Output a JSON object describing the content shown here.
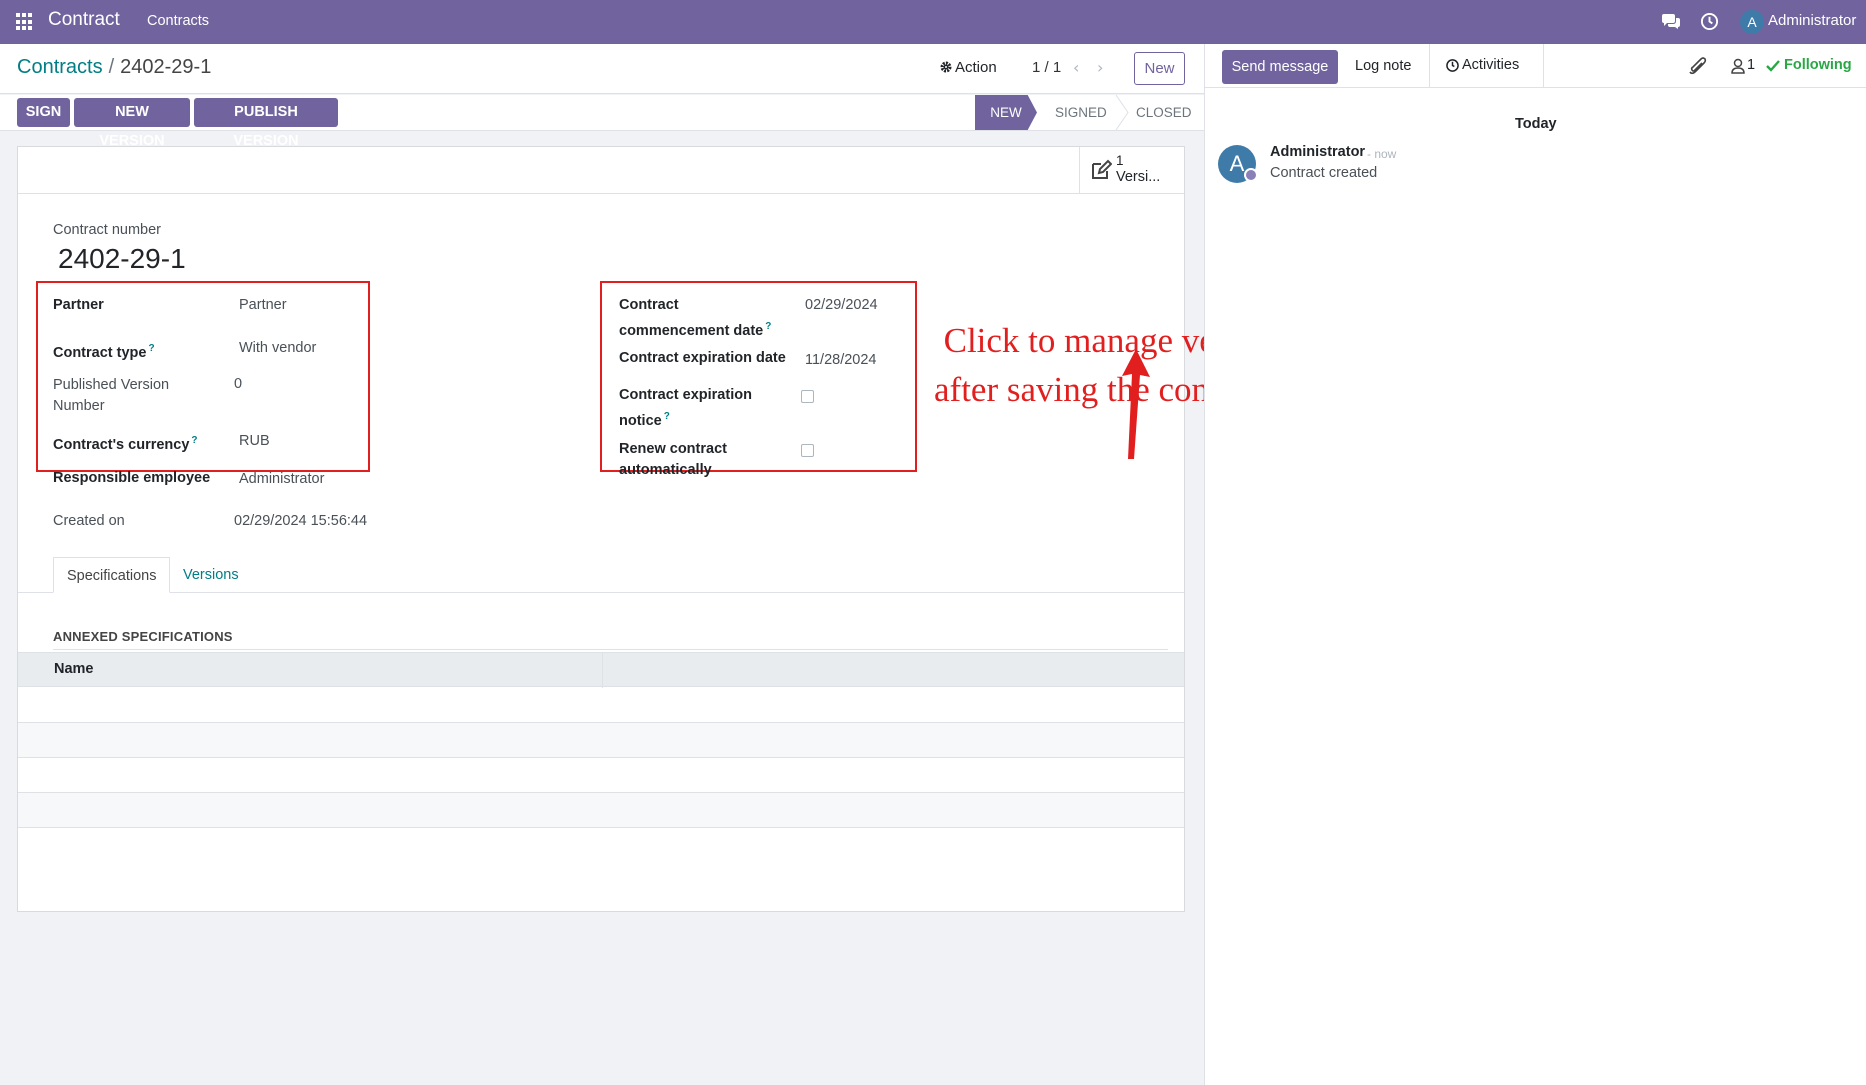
{
  "navbar": {
    "app_name": "Contract",
    "menu": "Contracts",
    "user_initial": "A",
    "user_name": "Administrator"
  },
  "control_panel": {
    "breadcrumb_parent": "Contracts",
    "breadcrumb_separator": "/",
    "breadcrumb_current": "2402-29-1",
    "action_label": "Action",
    "pager": "1 / 1",
    "new_label": "New"
  },
  "statusbar": {
    "buttons": [
      "SIGN",
      "NEW VERSION",
      "PUBLISH VERSION"
    ],
    "stages": [
      "NEW",
      "SIGNED",
      "CLOSED"
    ],
    "active_stage": "NEW"
  },
  "smart_button": {
    "count": "1",
    "label": "Versi...",
    "icon": "edit-icon"
  },
  "form": {
    "contract_number_label": "Contract number",
    "contract_number": "2402-29-1",
    "left_fields": [
      {
        "label": "Partner",
        "value": "Partner"
      },
      {
        "label": "Contract type",
        "value": "With vendor"
      },
      {
        "label": "Published Version Number",
        "value": "0"
      },
      {
        "label": "Contract's currency",
        "value": "RUB"
      },
      {
        "label": "Responsible employee",
        "value": "Administrator"
      }
    ],
    "created_on_label": "Created on",
    "created_on": "02/29/2024 15:56:44",
    "right_fields": [
      {
        "label": "Contract commencement date",
        "value": "02/29/2024"
      },
      {
        "label": "Contract expiration date",
        "value": "11/28/2024"
      },
      {
        "label": "Contract expiration notice",
        "checked": false
      },
      {
        "label": "Renew contract automatically",
        "checked": false
      }
    ],
    "tabs": [
      "Specifications",
      "Versions"
    ],
    "active_tab": "Specifications",
    "section_title": "ANNEXED SPECIFICATIONS",
    "table_header": "Name"
  },
  "annotation": {
    "line1": "Click to manage versions",
    "line2": "after saving the contract information.",
    "color": "#e21f1f"
  },
  "chatter": {
    "send_message": "Send message",
    "log_note": "Log note",
    "activities": "Activities",
    "followers_count": "1",
    "following": "Following",
    "date_separator": "Today",
    "message": {
      "avatar_initial": "A",
      "author": "Administrator",
      "time": "- now",
      "body": "Contract created"
    }
  },
  "colors": {
    "brand": "#71639e",
    "link": "#017e84",
    "highlight_box": "#e21f1f",
    "following": "#28a745"
  }
}
